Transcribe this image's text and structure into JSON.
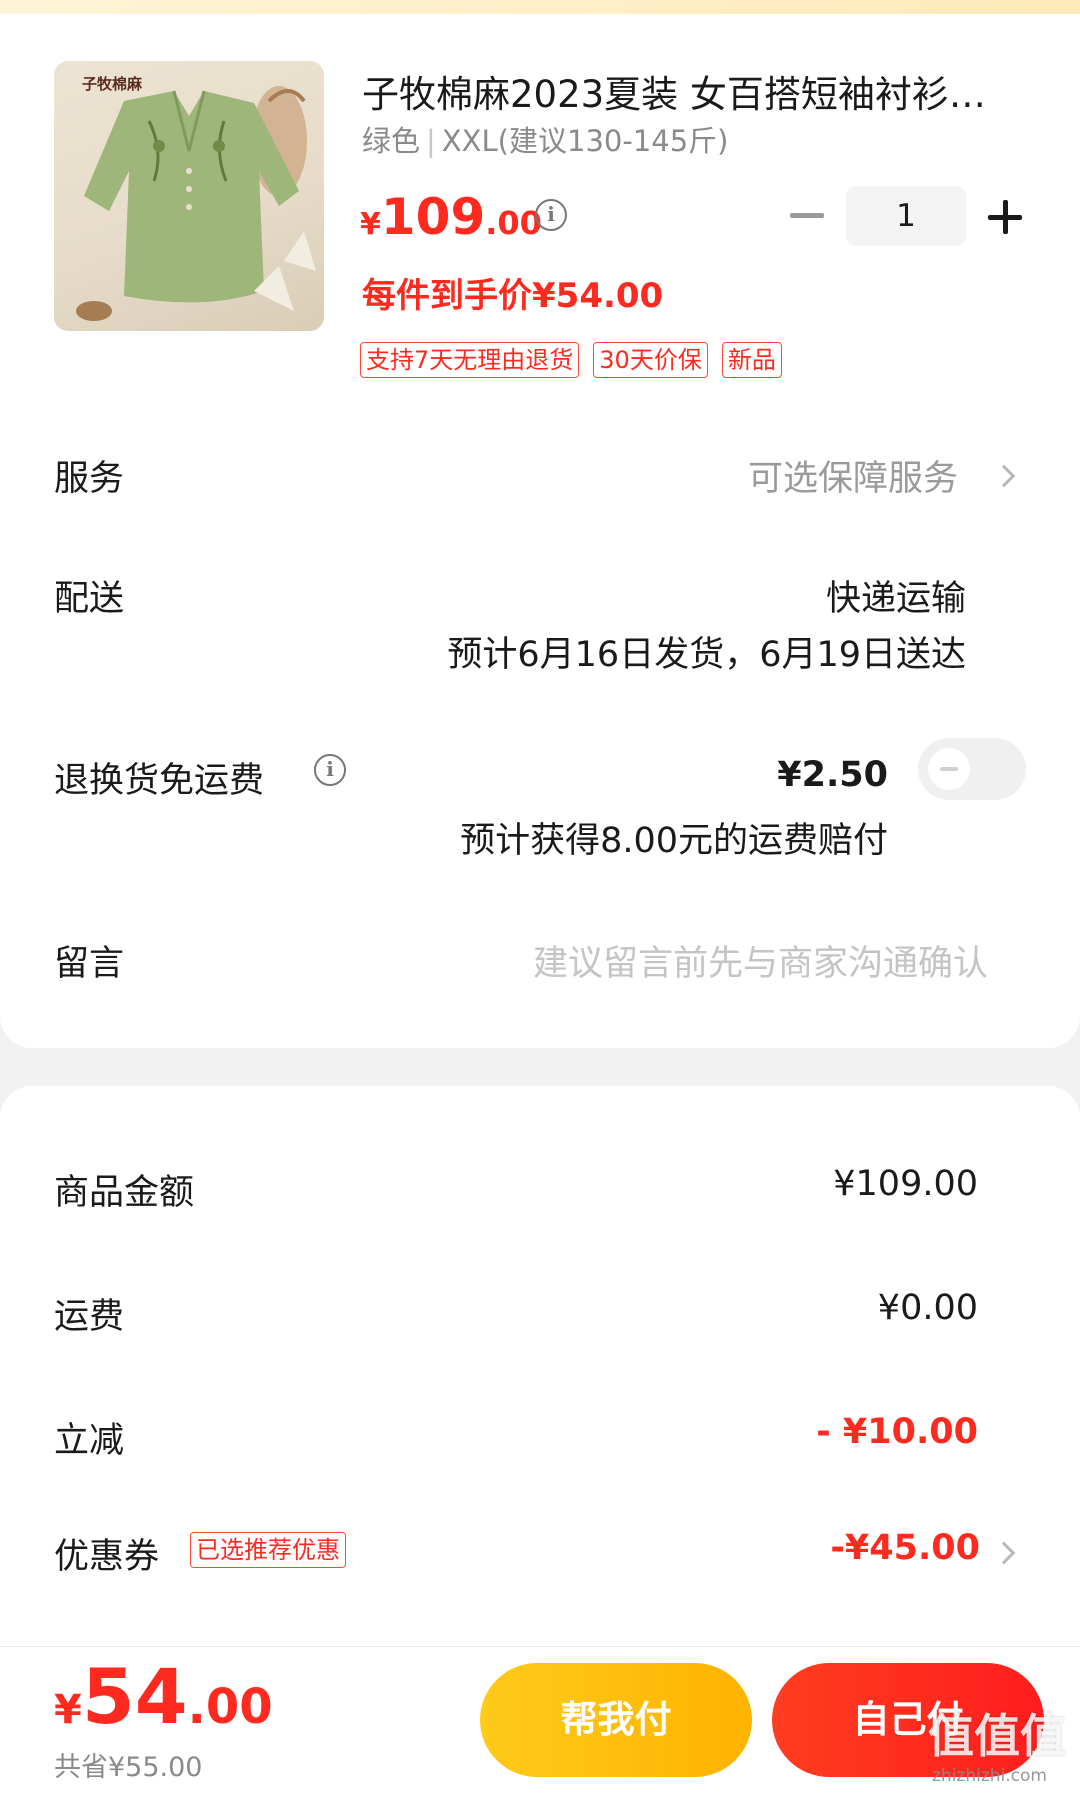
{
  "product": {
    "title": "子牧棉麻2023夏装 女百搭短袖衬衫…",
    "image_brand_text": "子牧棉麻",
    "sku_color": "绿色",
    "sku_size": "XXL(建议130-145斤)",
    "price_currency": "¥",
    "price_int": "109",
    "price_dec": ".00",
    "quantity": "1",
    "unit_price_text": "每件到手价¥54.00",
    "tags": [
      "支持7天无理由退货",
      "30天价保",
      "新品"
    ]
  },
  "service": {
    "label": "服务",
    "value": "可选保障服务"
  },
  "delivery": {
    "label": "配送",
    "method": "快递运输",
    "estimate": "预计6月16日发货，6月19日送达"
  },
  "return_shipping": {
    "label": "退换货免运费",
    "price": "¥2.50",
    "note": "预计获得8.00元的运费赔付",
    "enabled": false
  },
  "message": {
    "label": "留言",
    "placeholder": "建议留言前先与商家沟通确认"
  },
  "summary": {
    "goods_amount_label": "商品金额",
    "goods_amount": "¥109.00",
    "shipping_label": "运费",
    "shipping": "¥0.00",
    "discount_label": "立减",
    "discount": "- ¥10.00",
    "coupon_label": "优惠券",
    "coupon_tag": "已选推荐优惠",
    "coupon": "-¥45.00"
  },
  "bottom": {
    "total_currency": "¥",
    "total_int": "54",
    "total_dec": ".00",
    "saved": "共省¥55.00",
    "help_pay_label": "帮我付",
    "self_pay_label": "自己付"
  },
  "watermark": {
    "text": "值值值",
    "url": "zhizhizhi.com"
  },
  "colors": {
    "accent_red": "#ff2a1f",
    "help_button": "#ffc107",
    "pay_button": "#ff2a1f"
  }
}
